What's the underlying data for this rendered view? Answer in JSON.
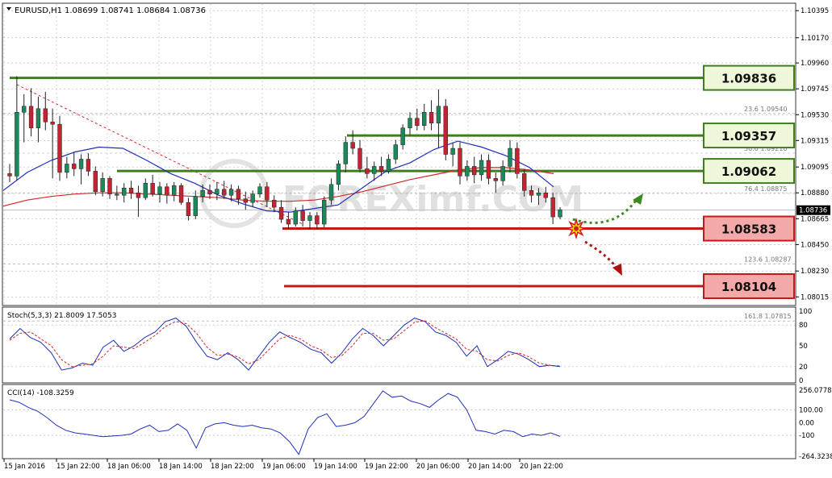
{
  "header": {
    "symbol": "EURUSD,H1",
    "ohlc": "1.08699 1.08741 1.08684 1.08736"
  },
  "watermark": "FOREXimf.COM",
  "colors": {
    "bull": "#1a8a5a",
    "bear": "#c42431",
    "resistance": "#3f7d1f",
    "support": "#c11a1a",
    "ma_blue": "#1f2fb8",
    "ma_red": "#d22a2a",
    "grid": "#b8b8b8"
  },
  "levels": {
    "resistance": [
      {
        "price": 1.09836,
        "label": "1.09836"
      },
      {
        "price": 1.09357,
        "label": "1.09357"
      },
      {
        "price": 1.09062,
        "label": "1.09062"
      }
    ],
    "support": [
      {
        "price": 1.08583,
        "label": "1.08583"
      },
      {
        "price": 1.08104,
        "label": "1.08104"
      }
    ]
  },
  "fibonacci": [
    {
      "ratio": "23.6",
      "price": "1.09540"
    },
    {
      "ratio": "50.0",
      "price": "1.09210"
    },
    {
      "ratio": "76.4",
      "price": "1.08875"
    },
    {
      "ratio": "123.6",
      "price": "1.08287"
    },
    {
      "ratio": "161.8",
      "price": "1.07815"
    }
  ],
  "chart_data": [
    {
      "type": "candlestick",
      "symbol": "EURUSD",
      "timeframe": "H1",
      "ylim": [
        1.0795,
        1.1045
      ],
      "price_ticks": [
        "1.10395",
        "1.10170",
        "1.09960",
        "1.09745",
        "1.09530",
        "1.09315",
        "1.09095",
        "1.08880",
        "1.08665",
        "1.08450",
        "1.08230",
        "1.08015"
      ],
      "current_price": "1.08736",
      "candles": [
        {
          "o": 1.0904,
          "h": 1.0912,
          "l": 1.0897,
          "c": 1.0902
        },
        {
          "o": 1.0902,
          "h": 1.0985,
          "l": 1.0898,
          "c": 1.0955
        },
        {
          "o": 1.0955,
          "h": 1.097,
          "l": 1.093,
          "c": 1.096
        },
        {
          "o": 1.096,
          "h": 1.0975,
          "l": 1.0935,
          "c": 1.0942
        },
        {
          "o": 1.0942,
          "h": 1.0968,
          "l": 1.093,
          "c": 1.0958
        },
        {
          "o": 1.0958,
          "h": 1.0972,
          "l": 1.094,
          "c": 1.0947
        },
        {
          "o": 1.0947,
          "h": 1.0958,
          "l": 1.09,
          "c": 1.0945
        },
        {
          "o": 1.0945,
          "h": 1.0952,
          "l": 1.0898,
          "c": 1.0905
        },
        {
          "o": 1.0905,
          "h": 1.0918,
          "l": 1.09,
          "c": 1.0912
        },
        {
          "o": 1.0912,
          "h": 1.0922,
          "l": 1.0902,
          "c": 1.0908
        },
        {
          "o": 1.0908,
          "h": 1.092,
          "l": 1.0895,
          "c": 1.0916
        },
        {
          "o": 1.0916,
          "h": 1.0921,
          "l": 1.0902,
          "c": 1.0906
        },
        {
          "o": 1.0906,
          "h": 1.091,
          "l": 1.0886,
          "c": 1.0889
        },
        {
          "o": 1.0889,
          "h": 1.0905,
          "l": 1.0885,
          "c": 1.09
        },
        {
          "o": 1.09,
          "h": 1.0902,
          "l": 1.0883,
          "c": 1.0887
        },
        {
          "o": 1.0887,
          "h": 1.0894,
          "l": 1.0882,
          "c": 1.0886
        },
        {
          "o": 1.0886,
          "h": 1.0896,
          "l": 1.088,
          "c": 1.0892
        },
        {
          "o": 1.0892,
          "h": 1.0898,
          "l": 1.0883,
          "c": 1.0888
        },
        {
          "o": 1.0888,
          "h": 1.0894,
          "l": 1.0868,
          "c": 1.0884
        },
        {
          "o": 1.0884,
          "h": 1.09,
          "l": 1.0882,
          "c": 1.0896
        },
        {
          "o": 1.0896,
          "h": 1.0903,
          "l": 1.0885,
          "c": 1.0887
        },
        {
          "o": 1.0887,
          "h": 1.0897,
          "l": 1.088,
          "c": 1.0893
        },
        {
          "o": 1.0893,
          "h": 1.0896,
          "l": 1.0879,
          "c": 1.0886
        },
        {
          "o": 1.0886,
          "h": 1.0897,
          "l": 1.0881,
          "c": 1.0894
        },
        {
          "o": 1.0894,
          "h": 1.0896,
          "l": 1.0878,
          "c": 1.088
        },
        {
          "o": 1.088,
          "h": 1.0884,
          "l": 1.0865,
          "c": 1.0869
        },
        {
          "o": 1.0869,
          "h": 1.089,
          "l": 1.0866,
          "c": 1.0885
        },
        {
          "o": 1.0885,
          "h": 1.0895,
          "l": 1.088,
          "c": 1.089
        },
        {
          "o": 1.089,
          "h": 1.0895,
          "l": 1.0883,
          "c": 1.0887
        },
        {
          "o": 1.0887,
          "h": 1.0897,
          "l": 1.0882,
          "c": 1.0891
        },
        {
          "o": 1.0891,
          "h": 1.0898,
          "l": 1.0883,
          "c": 1.0886
        },
        {
          "o": 1.0886,
          "h": 1.0895,
          "l": 1.0881,
          "c": 1.0891
        },
        {
          "o": 1.0891,
          "h": 1.0894,
          "l": 1.0878,
          "c": 1.0883
        },
        {
          "o": 1.0883,
          "h": 1.0889,
          "l": 1.0874,
          "c": 1.088
        },
        {
          "o": 1.088,
          "h": 1.089,
          "l": 1.0876,
          "c": 1.0887
        },
        {
          "o": 1.0887,
          "h": 1.0896,
          "l": 1.0884,
          "c": 1.0893
        },
        {
          "o": 1.0893,
          "h": 1.0897,
          "l": 1.0876,
          "c": 1.0882
        },
        {
          "o": 1.0882,
          "h": 1.0886,
          "l": 1.0872,
          "c": 1.0876
        },
        {
          "o": 1.0876,
          "h": 1.0882,
          "l": 1.0863,
          "c": 1.0866
        },
        {
          "o": 1.0866,
          "h": 1.0872,
          "l": 1.0858,
          "c": 1.0862
        },
        {
          "o": 1.0862,
          "h": 1.0876,
          "l": 1.086,
          "c": 1.0873
        },
        {
          "o": 1.0873,
          "h": 1.0878,
          "l": 1.086,
          "c": 1.0865
        },
        {
          "o": 1.0865,
          "h": 1.0872,
          "l": 1.0858,
          "c": 1.0869
        },
        {
          "o": 1.0869,
          "h": 1.0872,
          "l": 1.0858,
          "c": 1.0862
        },
        {
          "o": 1.0862,
          "h": 1.0885,
          "l": 1.0859,
          "c": 1.0882
        },
        {
          "o": 1.0882,
          "h": 1.09,
          "l": 1.0878,
          "c": 1.0895
        },
        {
          "o": 1.0895,
          "h": 1.0915,
          "l": 1.089,
          "c": 1.0912
        },
        {
          "o": 1.0912,
          "h": 1.0935,
          "l": 1.0905,
          "c": 1.093
        },
        {
          "o": 1.093,
          "h": 1.094,
          "l": 1.092,
          "c": 1.0925
        },
        {
          "o": 1.0925,
          "h": 1.0932,
          "l": 1.0905,
          "c": 1.0908
        },
        {
          "o": 1.0908,
          "h": 1.0918,
          "l": 1.09,
          "c": 1.0904
        },
        {
          "o": 1.0904,
          "h": 1.0914,
          "l": 1.0898,
          "c": 1.091
        },
        {
          "o": 1.091,
          "h": 1.0918,
          "l": 1.0902,
          "c": 1.0906
        },
        {
          "o": 1.0906,
          "h": 1.092,
          "l": 1.0904,
          "c": 1.0916
        },
        {
          "o": 1.0916,
          "h": 1.0932,
          "l": 1.0912,
          "c": 1.0928
        },
        {
          "o": 1.0928,
          "h": 1.0945,
          "l": 1.0924,
          "c": 1.0942
        },
        {
          "o": 1.0942,
          "h": 1.0955,
          "l": 1.0936,
          "c": 1.095
        },
        {
          "o": 1.095,
          "h": 1.0958,
          "l": 1.094,
          "c": 1.0944
        },
        {
          "o": 1.0944,
          "h": 1.0962,
          "l": 1.094,
          "c": 1.0955
        },
        {
          "o": 1.0955,
          "h": 1.0965,
          "l": 1.094,
          "c": 1.0946
        },
        {
          "o": 1.0946,
          "h": 1.0974,
          "l": 1.0925,
          "c": 1.096
        },
        {
          "o": 1.096,
          "h": 1.0966,
          "l": 1.0915,
          "c": 1.092
        },
        {
          "o": 1.092,
          "h": 1.093,
          "l": 1.091,
          "c": 1.0925
        },
        {
          "o": 1.0925,
          "h": 1.093,
          "l": 1.0895,
          "c": 1.0902
        },
        {
          "o": 1.0902,
          "h": 1.0915,
          "l": 1.0898,
          "c": 1.091
        },
        {
          "o": 1.091,
          "h": 1.0918,
          "l": 1.0896,
          "c": 1.0903
        },
        {
          "o": 1.0903,
          "h": 1.092,
          "l": 1.0898,
          "c": 1.0915
        },
        {
          "o": 1.0915,
          "h": 1.092,
          "l": 1.0895,
          "c": 1.09
        },
        {
          "o": 1.09,
          "h": 1.0905,
          "l": 1.0888,
          "c": 1.0898
        },
        {
          "o": 1.0898,
          "h": 1.0915,
          "l": 1.0894,
          "c": 1.091
        },
        {
          "o": 1.091,
          "h": 1.0932,
          "l": 1.0905,
          "c": 1.0925
        },
        {
          "o": 1.0925,
          "h": 1.093,
          "l": 1.09,
          "c": 1.0904
        },
        {
          "o": 1.0904,
          "h": 1.0908,
          "l": 1.0885,
          "c": 1.089
        },
        {
          "o": 1.089,
          "h": 1.0894,
          "l": 1.088,
          "c": 1.0886
        },
        {
          "o": 1.0886,
          "h": 1.0892,
          "l": 1.0878,
          "c": 1.0888
        },
        {
          "o": 1.0888,
          "h": 1.0893,
          "l": 1.088,
          "c": 1.0884
        },
        {
          "o": 1.0884,
          "h": 1.0888,
          "l": 1.0862,
          "c": 1.0868
        },
        {
          "o": 1.0868,
          "h": 1.0876,
          "l": 1.0866,
          "c": 1.0874
        }
      ],
      "ma_blue": [
        1.089,
        1.0905,
        1.0915,
        1.0922,
        1.0926,
        1.0925,
        1.0915,
        1.0904,
        1.0896,
        1.0886,
        1.0879,
        1.0873,
        1.0872,
        1.0875,
        1.0878,
        1.0892,
        1.0906,
        1.0913,
        1.0924,
        1.0931,
        1.0926,
        1.0919,
        1.0909,
        1.0893
      ],
      "ma_red": [
        1.0877,
        1.0882,
        1.0885,
        1.0887,
        1.0888,
        1.0888,
        1.0887,
        1.0886,
        1.0885,
        1.0884,
        1.0882,
        1.0881,
        1.0881,
        1.0882,
        1.0885,
        1.0889,
        1.0894,
        1.0899,
        1.0903,
        1.0907,
        1.0909,
        1.0909,
        1.0907,
        1.0904
      ],
      "fib_trend_line": {
        "from_price": 1.0978,
        "to_price": 1.0862
      }
    },
    {
      "type": "line",
      "name": "Stoch(5,3,3)",
      "header": "Stoch(5,3,3) 21.8009 17.5053",
      "ylim": [
        0,
        100
      ],
      "yticks": [
        "100",
        "80",
        "50",
        "20",
        "0"
      ],
      "series": [
        {
          "values": [
            60,
            75,
            62,
            55,
            40,
            15,
            18,
            25,
            22,
            48,
            58,
            42,
            50,
            62,
            70,
            85,
            90,
            78,
            55,
            35,
            30,
            40,
            30,
            15,
            35,
            55,
            70,
            62,
            55,
            45,
            40,
            25,
            40,
            60,
            75,
            65,
            50,
            65,
            80,
            90,
            85,
            70,
            65,
            55,
            35,
            50,
            20,
            30,
            42,
            38,
            30,
            20,
            22,
            20
          ]
        },
        {
          "values": [
            58,
            68,
            70,
            60,
            50,
            30,
            20,
            22,
            24,
            35,
            50,
            48,
            46,
            55,
            65,
            78,
            85,
            82,
            68,
            48,
            36,
            38,
            34,
            24,
            30,
            45,
            60,
            65,
            60,
            50,
            44,
            33,
            36,
            50,
            68,
            68,
            58,
            60,
            72,
            84,
            86,
            76,
            68,
            60,
            45,
            42,
            30,
            28,
            36,
            40,
            34,
            25,
            22,
            21
          ]
        }
      ],
      "last_values": [
        21.8009,
        17.5053
      ]
    },
    {
      "type": "line",
      "name": "CCI(14)",
      "header": "CCI(14) -108.3259",
      "ylim": [
        -264.3238,
        256.0778
      ],
      "yticks": [
        "256.0778",
        "100.00",
        "0.00",
        "-100",
        "-264.3238"
      ],
      "values": [
        180,
        160,
        120,
        90,
        40,
        -20,
        -60,
        -80,
        -90,
        -100,
        -110,
        -105,
        -100,
        -90,
        -50,
        -20,
        -70,
        -60,
        -10,
        -60,
        -200,
        -40,
        -10,
        0,
        -20,
        -30,
        -20,
        -40,
        -50,
        -80,
        -150,
        -250,
        -50,
        40,
        70,
        -30,
        -20,
        0,
        50,
        150,
        250,
        200,
        210,
        170,
        150,
        120,
        180,
        230,
        200,
        100,
        -60,
        -70,
        -90,
        -60,
        -70,
        -110,
        -90,
        -100,
        -80,
        -108
      ]
    }
  ],
  "time_axis": [
    "15 Jan 2016",
    "15 Jan 22:00",
    "18 Jan 06:00",
    "18 Jan 14:00",
    "18 Jan 22:00",
    "19 Jan 06:00",
    "19 Jan 14:00",
    "19 Jan 22:00",
    "20 Jan 06:00",
    "20 Jan 14:00",
    "20 Jan 22:00"
  ]
}
